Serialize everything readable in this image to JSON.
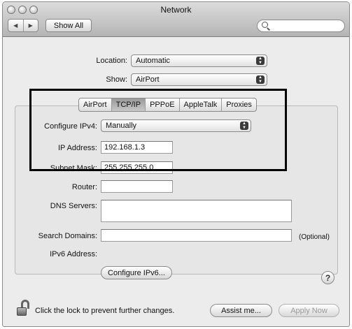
{
  "window": {
    "title": "Network"
  },
  "toolbar": {
    "show_all_label": "Show All",
    "search_value": ""
  },
  "location": {
    "label": "Location:",
    "value": "Automatic"
  },
  "show": {
    "label": "Show:",
    "value": "AirPort"
  },
  "tabs": [
    {
      "label": "AirPort",
      "selected": false
    },
    {
      "label": "TCP/IP",
      "selected": true
    },
    {
      "label": "PPPoE",
      "selected": false
    },
    {
      "label": "AppleTalk",
      "selected": false
    },
    {
      "label": "Proxies",
      "selected": false
    }
  ],
  "tcpip": {
    "configure_ipv4": {
      "label": "Configure IPv4:",
      "value": "Manually"
    },
    "ip_address": {
      "label": "IP Address:",
      "value": "192.168.1.3"
    },
    "subnet_mask": {
      "label": "Subnet Mask:",
      "value": "255.255.255.0"
    },
    "router": {
      "label": "Router:",
      "value": ""
    },
    "dns_servers": {
      "label": "DNS Servers:",
      "value": ""
    },
    "search_domains": {
      "label": "Search Domains:",
      "value": "",
      "hint": "(Optional)"
    },
    "ipv6_address": {
      "label": "IPv6 Address:",
      "value": ""
    },
    "configure_ipv6_label": "Configure IPv6..."
  },
  "footer": {
    "lock_text": "Click the lock to prevent further changes.",
    "assist_label": "Assist me...",
    "apply_label": "Apply Now"
  },
  "colors": {
    "window_bg": "#ececec",
    "highlight_border": "#000000"
  }
}
